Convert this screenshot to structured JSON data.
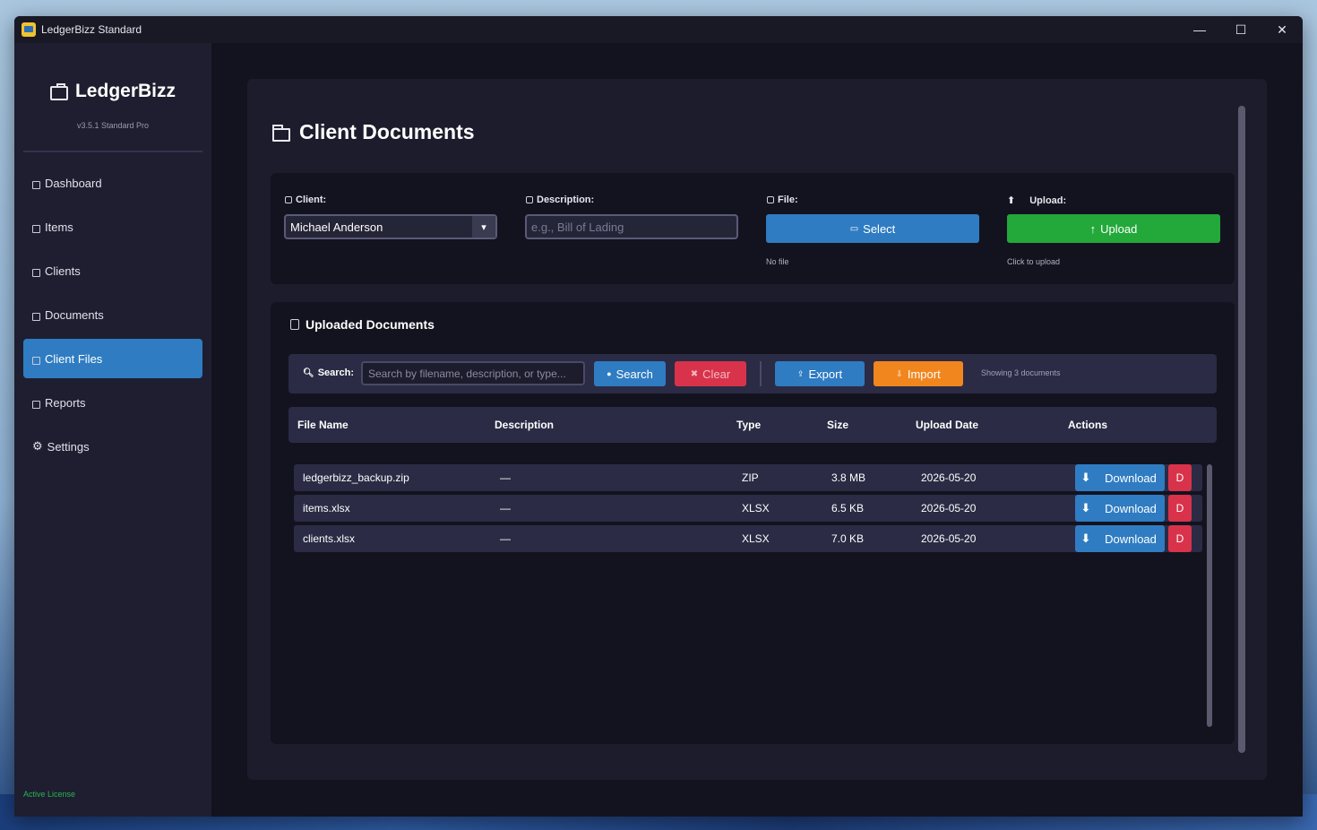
{
  "window": {
    "title": "LedgerBizz Standard",
    "minimize": "—",
    "maximize": "☐",
    "close": "✕"
  },
  "sidebar": {
    "brand": "LedgerBizz",
    "version": "v3.5.1 Standard Pro",
    "items": [
      {
        "label": "Dashboard",
        "icon": "dashboard-icon",
        "active": false
      },
      {
        "label": "Items",
        "icon": "items-icon",
        "active": false
      },
      {
        "label": "Clients",
        "icon": "clients-icon",
        "active": false
      },
      {
        "label": "Documents",
        "icon": "documents-icon",
        "active": false
      },
      {
        "label": "Client Files",
        "icon": "folder-icon",
        "active": true
      },
      {
        "label": "Reports",
        "icon": "reports-icon",
        "active": false
      },
      {
        "label": "Settings",
        "icon": "gear-icon",
        "active": false
      }
    ],
    "license": "Active License"
  },
  "page": {
    "title": "Client Documents"
  },
  "upload": {
    "client_label": "Client:",
    "client_value": "Michael Anderson",
    "description_label": "Description:",
    "description_placeholder": "e.g., Bill of Lading",
    "file_label": "File:",
    "select_label": "Select",
    "file_hint": "No file",
    "upload_label": "Upload:",
    "upload_button": "Upload",
    "upload_hint": "Click to upload"
  },
  "documents": {
    "title": "Uploaded Documents",
    "search_label": "Search:",
    "search_placeholder": "Search by filename, description, or type...",
    "search_button": "Search",
    "clear_button": "Clear",
    "export_button": "Export",
    "import_button": "Import",
    "showing": "Showing 3 documents",
    "columns": [
      "File Name",
      "Description",
      "Type",
      "Size",
      "Upload Date",
      "Actions"
    ],
    "rows": [
      {
        "name": "ledgerbizz_backup.zip",
        "description": "—",
        "type": "ZIP",
        "size": "3.8 MB",
        "date": "2026-05-20",
        "download": "Download",
        "delete": "D"
      },
      {
        "name": "items.xlsx",
        "description": "—",
        "type": "XLSX",
        "size": "6.5 KB",
        "date": "2026-05-20",
        "download": "Download",
        "delete": "D"
      },
      {
        "name": "clients.xlsx",
        "description": "—",
        "type": "XLSX",
        "size": "7.0 KB",
        "date": "2026-05-20",
        "download": "Download",
        "delete": "D"
      }
    ]
  },
  "colors": {
    "accent": "#2f7cc2",
    "success": "#23a83a",
    "danger": "#d8334a",
    "warning": "#f2861e",
    "license": "#29b44c"
  }
}
